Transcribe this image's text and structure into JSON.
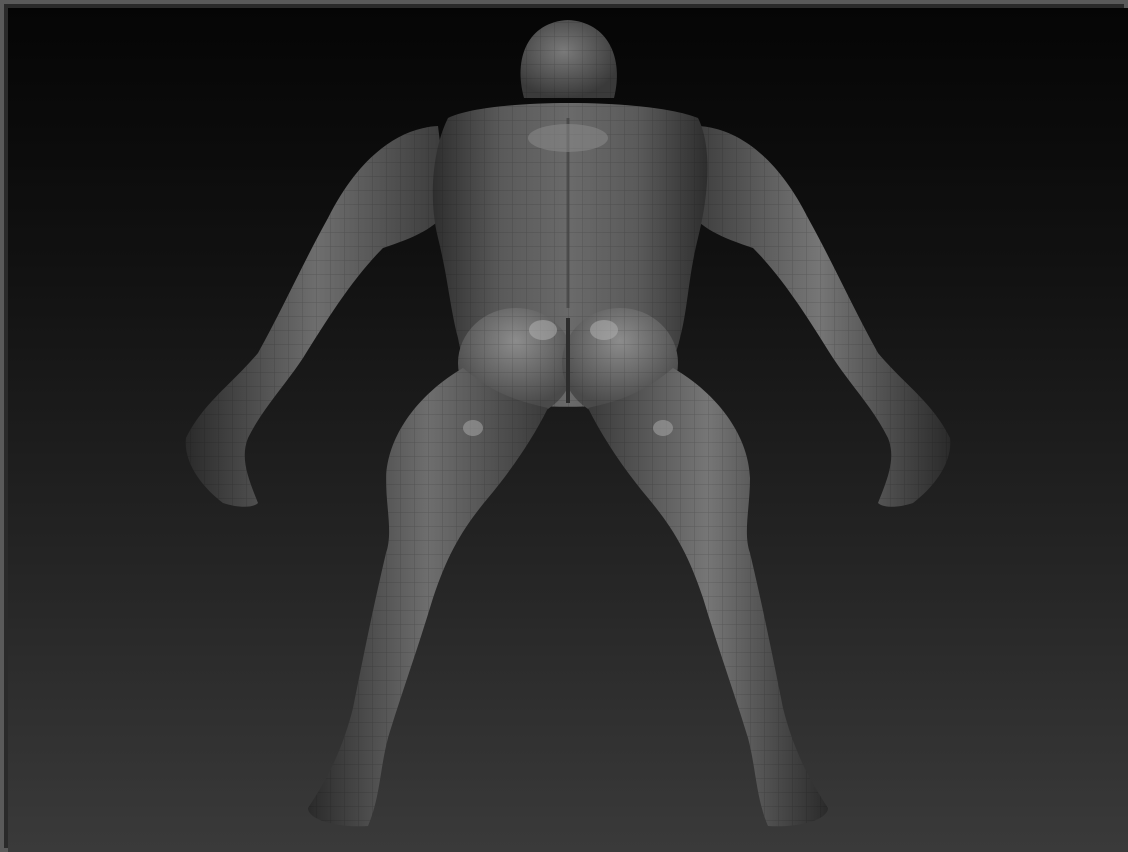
{
  "viewport": {
    "background_top": "#050505",
    "background_bottom": "#3a3a3a",
    "border_color": "#5a5a5a"
  },
  "model": {
    "material_base": "#5a5a5a",
    "material_highlight": "#9a9a9a",
    "material_shadow": "#2a2a2a",
    "wireframe_color": "#3e3e3e",
    "view": "back"
  }
}
